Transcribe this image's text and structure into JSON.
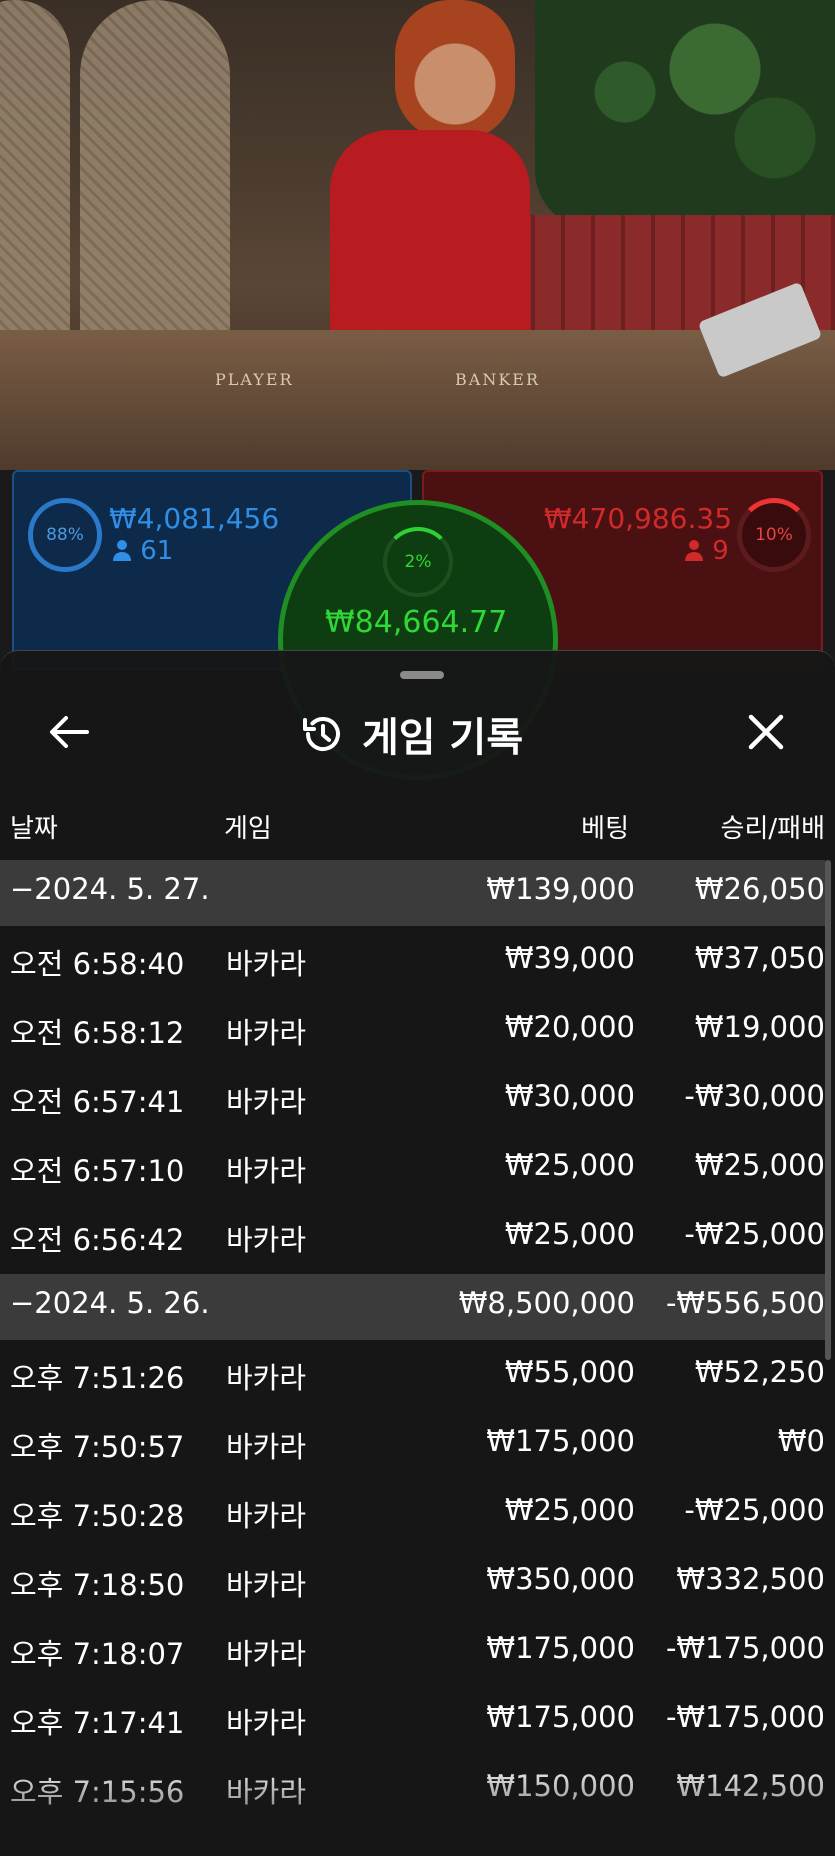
{
  "video": {
    "table_labels": {
      "player": "PLAYER",
      "banker": "BANKER"
    }
  },
  "bets": {
    "player": {
      "percent": "88%",
      "amount": "₩4,081,456",
      "players": "61"
    },
    "banker": {
      "percent": "10%",
      "amount": "₩470,986.35",
      "players": "9"
    },
    "tie": {
      "percent": "2%",
      "amount": "₩84,664.77"
    }
  },
  "history": {
    "title": "게임 기록",
    "columns": {
      "date": "날짜",
      "game": "게임",
      "bet": "베팅",
      "result": "승리/패배"
    },
    "groups": [
      {
        "date": "−2024. 5. 27.",
        "bet_total": "₩139,000",
        "result_total": "₩26,050",
        "rows": [
          {
            "time": "오전 6:58:40",
            "game": "바카라",
            "bet": "₩39,000",
            "result": "₩37,050"
          },
          {
            "time": "오전 6:58:12",
            "game": "바카라",
            "bet": "₩20,000",
            "result": "₩19,000"
          },
          {
            "time": "오전 6:57:41",
            "game": "바카라",
            "bet": "₩30,000",
            "result": "-₩30,000"
          },
          {
            "time": "오전 6:57:10",
            "game": "바카라",
            "bet": "₩25,000",
            "result": "₩25,000"
          },
          {
            "time": "오전 6:56:42",
            "game": "바카라",
            "bet": "₩25,000",
            "result": "-₩25,000"
          }
        ]
      },
      {
        "date": "−2024. 5. 26.",
        "bet_total": "₩8,500,000",
        "result_total": "-₩556,500",
        "rows": [
          {
            "time": "오후 7:51:26",
            "game": "바카라",
            "bet": "₩55,000",
            "result": "₩52,250"
          },
          {
            "time": "오후 7:50:57",
            "game": "바카라",
            "bet": "₩175,000",
            "result": "₩0"
          },
          {
            "time": "오후 7:50:28",
            "game": "바카라",
            "bet": "₩25,000",
            "result": "-₩25,000"
          },
          {
            "time": "오후 7:18:50",
            "game": "바카라",
            "bet": "₩350,000",
            "result": "₩332,500"
          },
          {
            "time": "오후 7:18:07",
            "game": "바카라",
            "bet": "₩175,000",
            "result": "-₩175,000"
          },
          {
            "time": "오후 7:17:41",
            "game": "바카라",
            "bet": "₩175,000",
            "result": "-₩175,000"
          },
          {
            "time": "오후 7:15:56",
            "game": "바카라",
            "bet": "₩150,000",
            "result": "₩142,500"
          }
        ]
      }
    ]
  },
  "icons": {
    "back": "arrow-left-icon",
    "history": "history-clock-icon",
    "close": "close-icon",
    "user": "user-icon"
  }
}
